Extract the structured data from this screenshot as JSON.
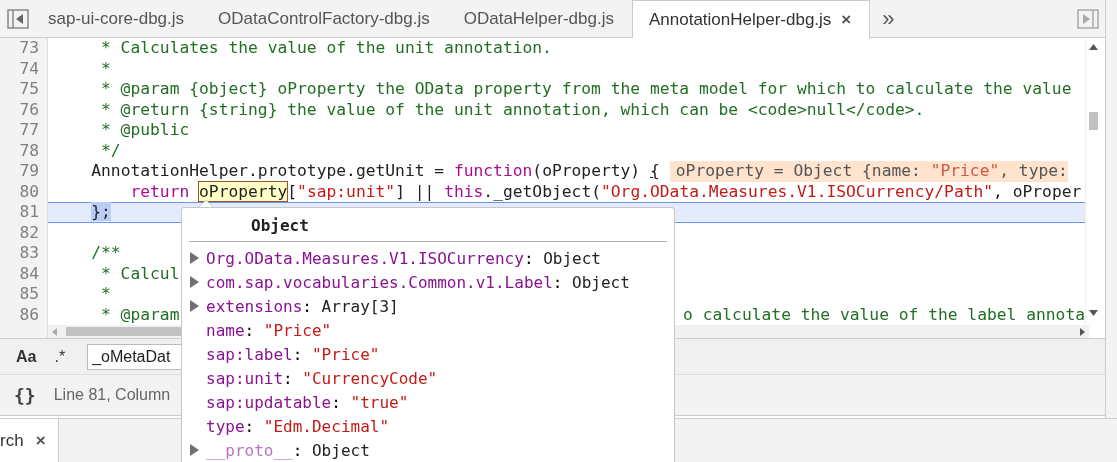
{
  "tabs": [
    {
      "label": "sap-ui-core-dbg.js",
      "selected": false,
      "closable": false
    },
    {
      "label": "ODataControlFactory-dbg.js",
      "selected": false,
      "closable": false
    },
    {
      "label": "ODataHelper-dbg.js",
      "selected": false,
      "closable": false
    },
    {
      "label": "AnnotationHelper-dbg.js",
      "selected": true,
      "closable": true,
      "close_glyph": "×"
    }
  ],
  "more_tabs": "»",
  "code": {
    "lines": [
      {
        "number": "73",
        "selected": false,
        "tokens": [
          {
            "kind": "comment",
            "text": "     * Calculates the value of the unit annotation."
          }
        ]
      },
      {
        "number": "74",
        "selected": false,
        "tokens": [
          {
            "kind": "comment",
            "text": "     *"
          }
        ]
      },
      {
        "number": "75",
        "selected": false,
        "tokens": [
          {
            "kind": "comment",
            "text": "     * @param {object} oProperty the OData property from the meta model for which to calculate the value"
          }
        ]
      },
      {
        "number": "76",
        "selected": false,
        "tokens": [
          {
            "kind": "comment",
            "text": "     * @return {string} the value of the unit annotation, which can be <code>null</code>."
          }
        ]
      },
      {
        "number": "77",
        "selected": false,
        "tokens": [
          {
            "kind": "comment",
            "text": "     * @public"
          }
        ]
      },
      {
        "number": "78",
        "selected": false,
        "tokens": [
          {
            "kind": "comment",
            "text": "     */"
          }
        ]
      },
      {
        "number": "79",
        "selected": false,
        "tokens": [
          {
            "kind": "plain",
            "text": "    AnnotationHelper.prototype.getUnit = "
          },
          {
            "kind": "keyword",
            "text": "function"
          },
          {
            "kind": "plain",
            "text": "(oProperty) "
          },
          {
            "kind": "match",
            "text": "{"
          }
        ],
        "inline_value": [
          {
            "kind": "plain",
            "text": "oProperty = Object {name: "
          },
          {
            "kind": "string",
            "text": "\"Price\""
          },
          {
            "kind": "plain",
            "text": ", type:"
          }
        ]
      },
      {
        "number": "80",
        "selected": false,
        "tokens": [
          {
            "kind": "keyword",
            "text": "        return "
          },
          {
            "kind": "hover",
            "text": "oProperty"
          },
          {
            "kind": "plain",
            "text": "["
          },
          {
            "kind": "string",
            "text": "\"sap:unit\""
          },
          {
            "kind": "plain",
            "text": "] || "
          },
          {
            "kind": "keyword",
            "text": "this"
          },
          {
            "kind": "plain",
            "text": "._getObject("
          },
          {
            "kind": "string",
            "text": "\"Org.OData.Measures.V1.ISOCurrency/Path\""
          },
          {
            "kind": "plain",
            "text": ", oProper"
          }
        ]
      },
      {
        "number": "81",
        "selected": true,
        "tokens": [
          {
            "kind": "selection",
            "text": "    };"
          }
        ]
      },
      {
        "number": "82",
        "selected": false
      },
      {
        "number": "83",
        "selected": false,
        "tokens": [
          {
            "kind": "comment",
            "text": "    /**"
          }
        ]
      },
      {
        "number": "84",
        "selected": false,
        "tokens": [
          {
            "kind": "comment",
            "text": "     * Calcul"
          }
        ]
      },
      {
        "number": "85",
        "selected": false,
        "tokens": [
          {
            "kind": "comment",
            "text": "     *"
          }
        ]
      },
      {
        "number": "86",
        "selected": false,
        "tokens": [
          {
            "kind": "comment",
            "text": "     * @param"
          }
        ],
        "right_tokens": [
          {
            "kind": "comment",
            "text": "o calculate the value of the label annota"
          }
        ]
      }
    ]
  },
  "search": {
    "case_button": "Aa",
    "regex_button": ".*",
    "value": "_oMetaDat"
  },
  "status_bar": {
    "format_button": "{}",
    "position": "Line 81, Column"
  },
  "drawer_tab": {
    "label": "rch",
    "close_glyph": "×"
  },
  "popover": {
    "title": "Object",
    "separator": ":",
    "entries": [
      {
        "key": "Org.OData.Measures.V1.ISOCurrency",
        "value": "Object",
        "kind": "object",
        "expandable": true,
        "internal": false
      },
      {
        "key": "com.sap.vocabularies.Common.v1.Label",
        "value": "Object",
        "kind": "object",
        "expandable": true,
        "internal": false
      },
      {
        "key": "extensions",
        "value": "Array[3]",
        "kind": "object",
        "expandable": true,
        "internal": false
      },
      {
        "key": "name",
        "value": "\"Price\"",
        "kind": "string",
        "expandable": false,
        "internal": false
      },
      {
        "key": "sap:label",
        "value": "\"Price\"",
        "kind": "string",
        "expandable": false,
        "internal": false
      },
      {
        "key": "sap:unit",
        "value": "\"CurrencyCode\"",
        "kind": "string",
        "expandable": false,
        "internal": false
      },
      {
        "key": "sap:updatable",
        "value": "\"true\"",
        "kind": "string",
        "expandable": false,
        "internal": false
      },
      {
        "key": "type",
        "value": "\"Edm.Decimal\"",
        "kind": "string",
        "expandable": false,
        "internal": false
      },
      {
        "key": "__proto__",
        "value": "Object",
        "kind": "object",
        "expandable": true,
        "internal": true
      }
    ]
  }
}
